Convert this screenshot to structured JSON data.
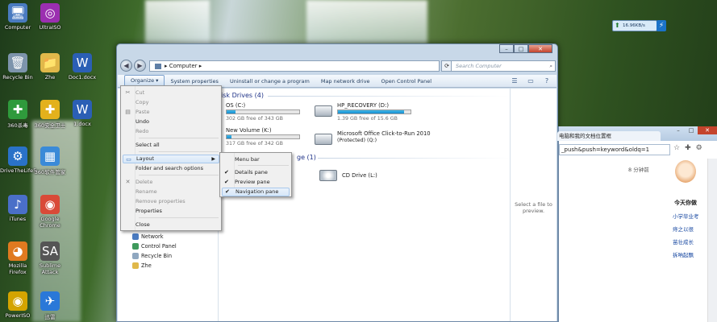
{
  "desktop": {
    "icons": [
      {
        "label": "Computer",
        "icon": "computer-icon"
      },
      {
        "label": "UltraISO",
        "icon": "disc-icon"
      },
      {
        "label": "Recycle Bin",
        "icon": "recycle-bin-icon"
      },
      {
        "label": "Zhe",
        "icon": "folder-icon"
      },
      {
        "label": "Doc1.docx",
        "icon": "word-doc-icon"
      },
      {
        "label": "360杀毒",
        "icon": "antivirus-icon"
      },
      {
        "label": "360安全卫士",
        "icon": "security-guard-icon"
      },
      {
        "label": "1.docx",
        "icon": "word-doc-icon"
      },
      {
        "label": "DriveTheLife5",
        "icon": "driver-icon"
      },
      {
        "label": "360软件管家",
        "icon": "software-manager-icon"
      },
      {
        "label": "iTunes",
        "icon": "itunes-icon"
      },
      {
        "label": "Google Chrome",
        "icon": "chrome-icon"
      },
      {
        "label": "Mozilla Firefox",
        "icon": "firefox-icon"
      },
      {
        "label": "Sublime Attack",
        "icon": "sa-app-icon"
      },
      {
        "label": "PowerISO",
        "icon": "poweriso-icon"
      },
      {
        "label": "迅雷",
        "icon": "thunder-icon"
      }
    ],
    "netmeter": {
      "value": "16.96KB/s"
    }
  },
  "explorer": {
    "address": "Computer",
    "search_placeholder": "Search Computer",
    "toolbar": {
      "organize": "Organize ▾",
      "system_properties": "System properties",
      "uninstall": "Uninstall or change a program",
      "map_drive": "Map network drive",
      "control_panel": "Open Control Panel"
    },
    "groups": {
      "hard_disk": "isk Drives (4)",
      "removable": "ge (1)"
    },
    "drives": [
      {
        "name": "OS (C:)",
        "free": "302 GB free of 343 GB",
        "used_fraction": 0.12
      },
      {
        "name": "HP_RECOVERY (D:)",
        "free": "1.39 GB free of 15.6 GB",
        "used_fraction": 0.91
      },
      {
        "name": "New Volume (K:)",
        "free": "317 GB free of 342 GB",
        "used_fraction": 0.07
      },
      {
        "name": "Microsoft Office Click-to-Run 2010",
        "free": "(Protected) (Q:)",
        "used_fraction": null
      },
      {
        "name": "CD Drive (L:)",
        "free": "",
        "used_fraction": null
      }
    ],
    "nav": [
      {
        "label": "Network"
      },
      {
        "label": "Control Panel"
      },
      {
        "label": "Recycle Bin"
      },
      {
        "label": "Zhe"
      }
    ],
    "preview_text": "Select a file to preview."
  },
  "organize_menu": [
    {
      "label": "Cut",
      "disabled": true,
      "icon": "scissors-icon"
    },
    {
      "label": "Copy",
      "disabled": true,
      "icon": ""
    },
    {
      "label": "Paste",
      "disabled": true,
      "icon": "paste-icon"
    },
    {
      "label": "Undo",
      "disabled": false,
      "icon": ""
    },
    {
      "label": "Redo",
      "disabled": true,
      "icon": ""
    },
    {
      "label": "Select all",
      "disabled": false,
      "icon": ""
    },
    {
      "label": "Layout",
      "disabled": false,
      "icon": "layout-icon",
      "submenu": true
    },
    {
      "label": "Folder and search options",
      "disabled": false,
      "icon": ""
    },
    {
      "label": "Delete",
      "disabled": true,
      "icon": "delete-icon"
    },
    {
      "label": "Rename",
      "disabled": true,
      "icon": ""
    },
    {
      "label": "Remove properties",
      "disabled": true,
      "icon": ""
    },
    {
      "label": "Properties",
      "disabled": false,
      "icon": ""
    },
    {
      "label": "Close",
      "disabled": false,
      "icon": ""
    }
  ],
  "layout_submenu": [
    {
      "label": "Menu bar",
      "checked": false
    },
    {
      "label": "Details pane",
      "checked": true
    },
    {
      "label": "Preview pane",
      "checked": true
    },
    {
      "label": "Navigation pane",
      "checked": true
    }
  ],
  "browser": {
    "tab_title": "电脑和我的文档位置框",
    "url": "_push&push=keyword&oldq=1",
    "time_text": "8 分钟前",
    "side_heading": "今天你做",
    "links": [
      "小学毕业考",
      "痔之以很",
      "苗壮成长",
      "拆呐起飘"
    ]
  },
  "colors": {
    "accent": "#1e3287",
    "drive_bar": "#1a8ccf",
    "close": "#c4442c"
  }
}
